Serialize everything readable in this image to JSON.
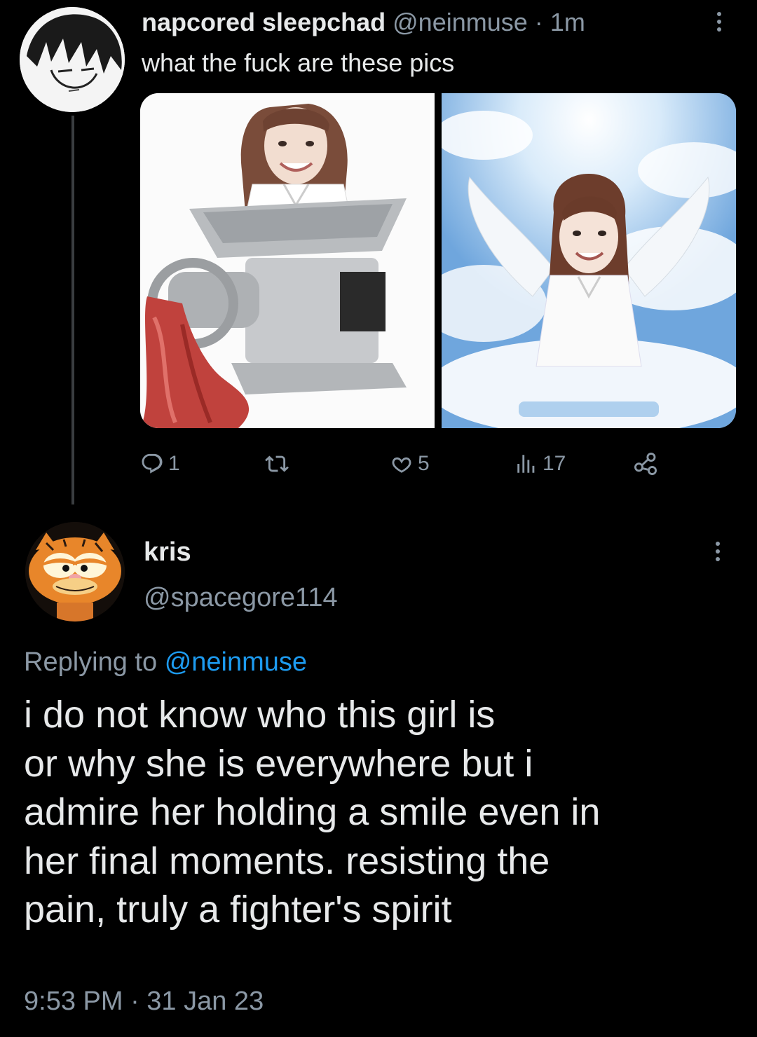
{
  "parent_tweet": {
    "display_name": "napcored sleepchad",
    "handle": "@neinmuse",
    "separator": "·",
    "time": "1m",
    "text": "what the fuck are these pics",
    "media": [
      {
        "description": "meat grinder image",
        "icon": "image"
      },
      {
        "description": "angel clouds image",
        "icon": "image"
      }
    ],
    "actions": {
      "reply_count": "1",
      "retweet_count": "",
      "like_count": "5",
      "view_count": "17"
    }
  },
  "reply_tweet": {
    "display_name": "kris",
    "handle": "@spacegore114",
    "replying_prefix": "Replying to",
    "replying_mention": "@neinmuse",
    "text_lines": [
      "i do not know who this girl is",
      "or why she is everywhere but i",
      "admire her holding a smile even in",
      "her final moments. resisting the",
      "pain, truly a fighter's spirit"
    ],
    "timestamp": "9:53 PM · 31 Jan 23"
  },
  "colors": {
    "background": "#000000",
    "primary_text": "#e7e9ea",
    "secondary_text": "#8b98a5",
    "accent": "#1d9bf0"
  }
}
